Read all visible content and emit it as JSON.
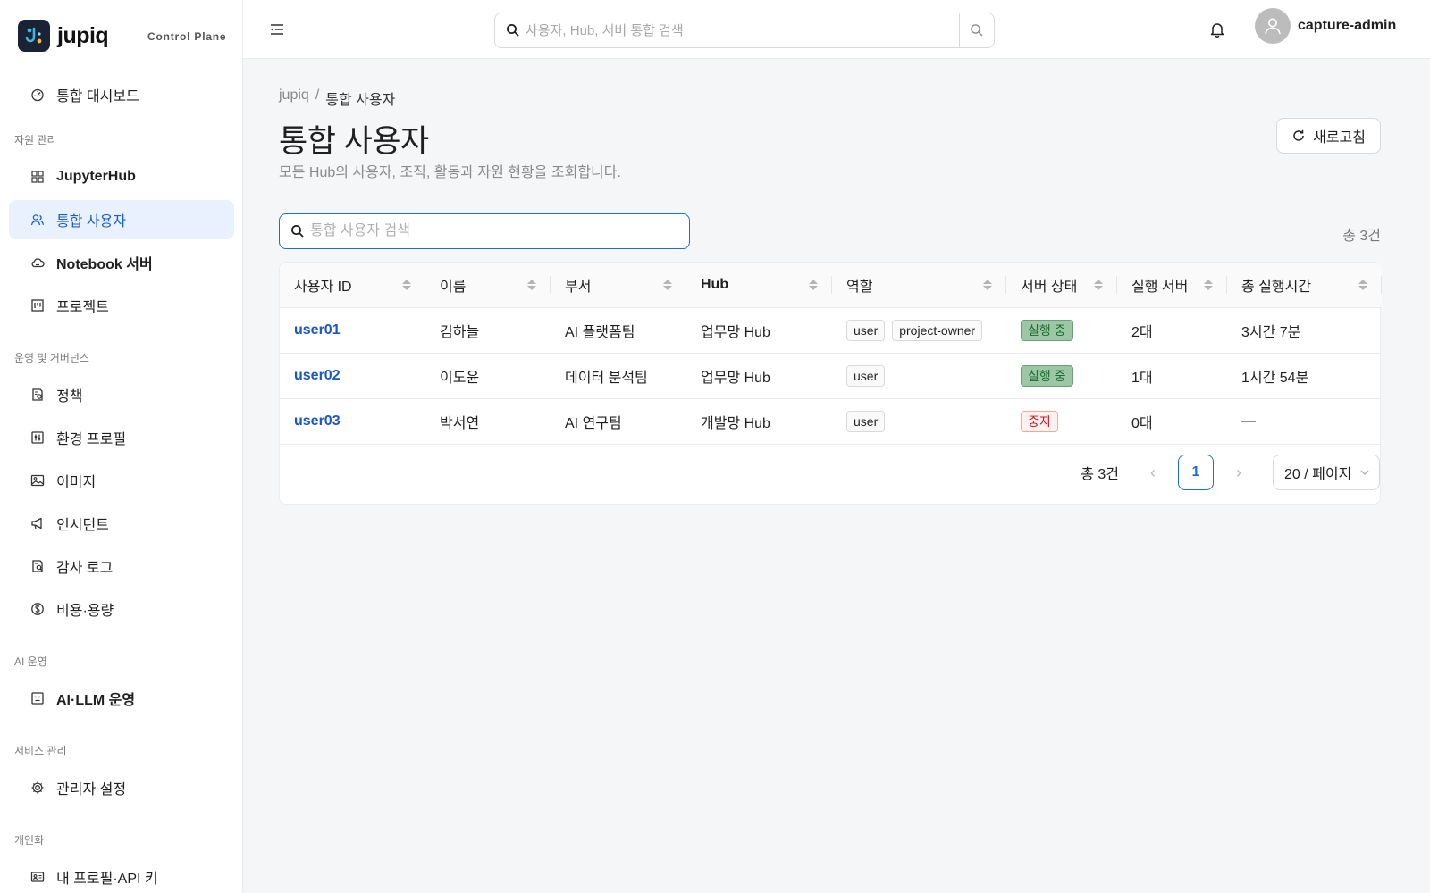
{
  "brand": {
    "name": "jupiq",
    "subtitle": "Control Plane"
  },
  "sidebar": {
    "top_item": {
      "label": "통합 대시보드",
      "icon": "dashboard-icon"
    },
    "groups": [
      {
        "title": "자원 관리",
        "items": [
          {
            "label": "JupyterHub",
            "icon": "grid-icon"
          },
          {
            "label": "통합 사용자",
            "icon": "users-icon",
            "active": true
          },
          {
            "label": "Notebook 서버",
            "icon": "cloud-icon"
          },
          {
            "label": "프로젝트",
            "icon": "project-icon"
          }
        ]
      },
      {
        "title": "운영 및 거버넌스",
        "items": [
          {
            "label": "정책",
            "icon": "policy-icon"
          },
          {
            "label": "환경 프로필",
            "icon": "sliders-icon"
          },
          {
            "label": "이미지",
            "icon": "image-icon"
          },
          {
            "label": "인시던트",
            "icon": "megaphone-icon"
          },
          {
            "label": "감사 로그",
            "icon": "audit-icon"
          },
          {
            "label": "비용·용량",
            "icon": "dollar-icon"
          }
        ]
      },
      {
        "title": "AI 운영",
        "items": [
          {
            "label": "AI·LLM 운영",
            "icon": "robot-icon"
          }
        ]
      },
      {
        "title": "서비스 관리",
        "items": [
          {
            "label": "관리자 설정",
            "icon": "gear-icon"
          }
        ]
      },
      {
        "title": "개인화",
        "items": [
          {
            "label": "내 프로필·API 키",
            "icon": "id-card-icon"
          }
        ]
      }
    ]
  },
  "topbar": {
    "search_placeholder": "사용자, Hub, 서버 통합 검색",
    "username": "capture-admin"
  },
  "breadcrumb": {
    "root": "jupiq",
    "separator": "/",
    "current": "통합 사용자"
  },
  "page": {
    "title": "통합 사용자",
    "description": "모든 Hub의 사용자, 조직, 활동과 자원 현황을 조회합니다.",
    "refresh_label": "새로고침"
  },
  "table_search": {
    "placeholder": "통합 사용자 검색"
  },
  "total_label": "총 3건",
  "table": {
    "columns": [
      "사용자 ID",
      "이름",
      "부서",
      "Hub",
      "역할",
      "서버 상태",
      "실행 서버",
      "총 실행시간"
    ],
    "rows": [
      {
        "user_id": "user01",
        "name": "김하늘",
        "dept": "AI 플랫폼팀",
        "hub": "업무망 Hub",
        "roles": [
          "user",
          "project-owner"
        ],
        "status": "실행 중",
        "status_kind": "running",
        "servers": "2대",
        "runtime": "3시간 7분"
      },
      {
        "user_id": "user02",
        "name": "이도윤",
        "dept": "데이터 분석팀",
        "hub": "업무망 Hub",
        "roles": [
          "user"
        ],
        "status": "실행 중",
        "status_kind": "running",
        "servers": "1대",
        "runtime": "1시간 54분"
      },
      {
        "user_id": "user03",
        "name": "박서연",
        "dept": "AI 연구팀",
        "hub": "개발망 Hub",
        "roles": [
          "user"
        ],
        "status": "중지",
        "status_kind": "stopped",
        "servers": "0대",
        "runtime": "—"
      }
    ]
  },
  "pagination": {
    "total_label": "총 3건",
    "current_page": "1",
    "prev": "‹",
    "next": "›",
    "page_size": "20 / 페이지"
  },
  "colors": {
    "accent": "#1a6ed8",
    "link": "#1a56c4",
    "running_bg": "#9bc7a4",
    "stopped_text": "#cf1322"
  }
}
